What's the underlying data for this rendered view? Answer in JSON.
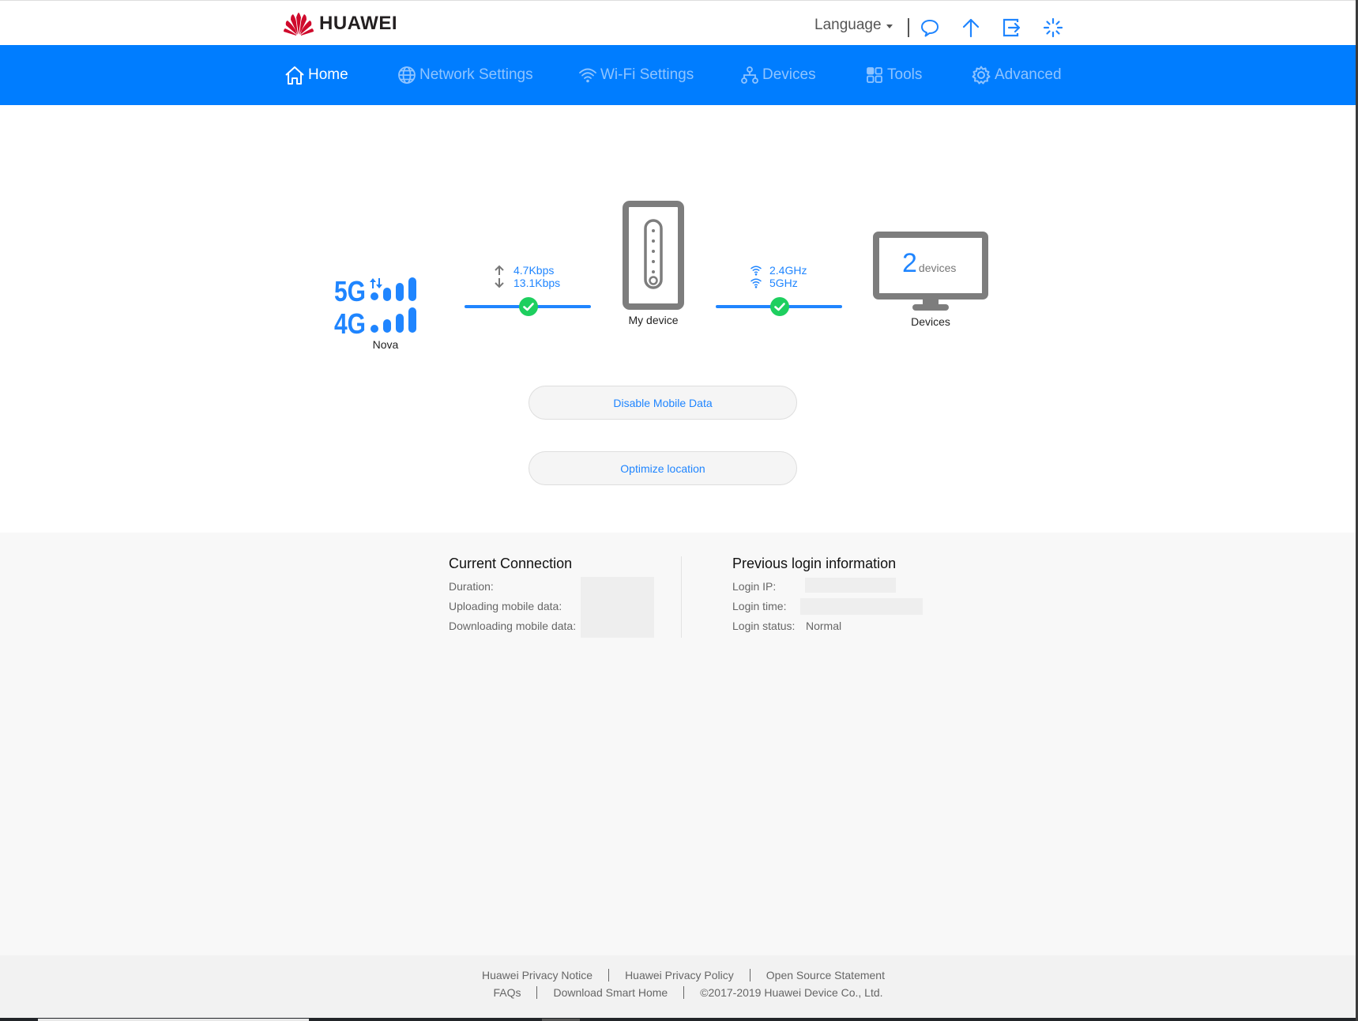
{
  "header": {
    "brand": "HUAWEI",
    "brand_color": "#cf0a2c",
    "language_label": "Language",
    "icons": [
      "message-icon",
      "update-arrow-icon",
      "logout-icon",
      "loading-spinner-icon"
    ]
  },
  "nav": {
    "accent": "#007dff",
    "items": [
      {
        "label": "Home",
        "icon": "home-icon",
        "active": true
      },
      {
        "label": "Network Settings",
        "icon": "globe-icon",
        "active": false
      },
      {
        "label": "Wi-Fi Settings",
        "icon": "wifi-icon",
        "active": false
      },
      {
        "label": "Devices",
        "icon": "network-topology-icon",
        "active": false
      },
      {
        "label": "Tools",
        "icon": "grid-icon",
        "active": false
      },
      {
        "label": "Advanced",
        "icon": "gear-icon",
        "active": false
      }
    ]
  },
  "topology": {
    "network": {
      "label": "Nova",
      "tech_top": "5G",
      "tech_bottom": "4G"
    },
    "speed": {
      "upload": "4.7Kbps",
      "download": "13.1Kbps"
    },
    "device": {
      "label": "My device"
    },
    "wifi": {
      "band1": "2.4GHz",
      "band2": "5GHz"
    },
    "clients": {
      "count": "2",
      "unit": "devices",
      "label": "Devices"
    },
    "status_color": "#1ecf5f"
  },
  "actions": {
    "disable_mobile_data": "Disable Mobile Data",
    "optimize_location": "Optimize location"
  },
  "current_connection": {
    "title": "Current Connection",
    "rows": [
      {
        "label": "Duration:"
      },
      {
        "label": "Uploading mobile data:"
      },
      {
        "label": "Downloading mobile data:"
      }
    ]
  },
  "previous_login": {
    "title": "Previous login information",
    "ip_label": "Login IP:",
    "time_label": "Login time:",
    "status_label": "Login status:",
    "status_value": "Normal"
  },
  "footer": {
    "row1": [
      "Huawei Privacy Notice",
      "Huawei Privacy Policy",
      "Open Source Statement"
    ],
    "row2": [
      "FAQs",
      "Download Smart Home"
    ],
    "copyright": "©2017-2019 Huawei Device Co., Ltd."
  }
}
